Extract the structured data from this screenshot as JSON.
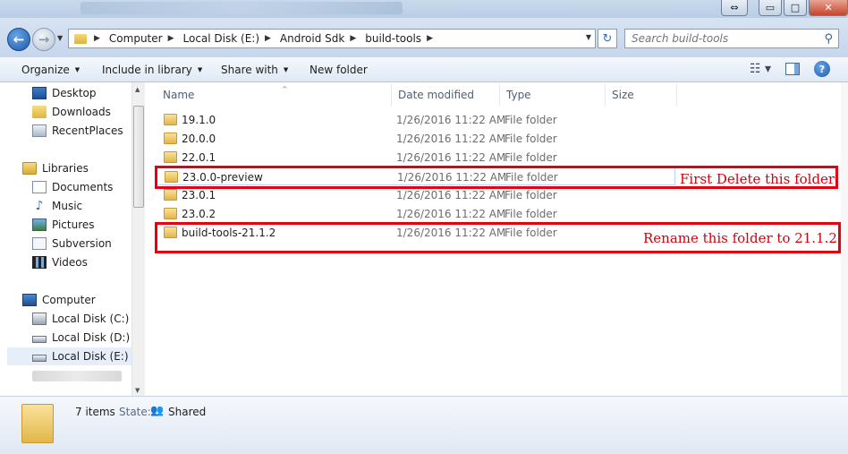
{
  "window": {
    "resize_glyph": "⇔",
    "min_glyph": "▭",
    "max_glyph": "□",
    "close_glyph": "✕"
  },
  "address": {
    "back_glyph": "←",
    "forward_glyph": "→",
    "crumbs": [
      "Computer",
      "Local Disk (E:)",
      "Android Sdk",
      "build-tools"
    ],
    "search_placeholder": "Search build-tools"
  },
  "toolbar": {
    "organize": "Organize",
    "include_in_library": "Include in library",
    "share_with": "Share with",
    "new_folder": "New folder"
  },
  "nav": {
    "favorites": [
      "Desktop",
      "Downloads",
      "RecentPlaces"
    ],
    "libraries_label": "Libraries",
    "libraries": [
      "Documents",
      "Music",
      "Pictures",
      "Subversion",
      "Videos"
    ],
    "computer_label": "Computer",
    "drives": [
      "Local Disk (C:)",
      "Local Disk (D:)",
      "Local Disk (E:)"
    ]
  },
  "columns": {
    "name": "Name",
    "date_modified": "Date modified",
    "type": "Type",
    "size": "Size"
  },
  "files": [
    {
      "name": "19.1.0",
      "date": "1/26/2016 11:22 AM",
      "type": "File folder"
    },
    {
      "name": "20.0.0",
      "date": "1/26/2016 11:22 AM",
      "type": "File folder"
    },
    {
      "name": "22.0.1",
      "date": "1/26/2016 11:22 AM",
      "type": "File folder"
    },
    {
      "name": "23.0.0-preview",
      "date": "1/26/2016 11:22 AM",
      "type": "File folder"
    },
    {
      "name": "23.0.1",
      "date": "1/26/2016 11:22 AM",
      "type": "File folder"
    },
    {
      "name": "23.0.2",
      "date": "1/26/2016 11:22 AM",
      "type": "File folder"
    },
    {
      "name": "build-tools-21.1.2",
      "date": "1/26/2016 11:22 AM",
      "type": "File folder"
    }
  ],
  "annotations": {
    "delete_note": "First Delete this folder",
    "rename_note": "Rename this folder to 21.1.2",
    "color": "#e3000f"
  },
  "status": {
    "items": "7 items",
    "state_label": "State:",
    "state_value": "Shared"
  }
}
